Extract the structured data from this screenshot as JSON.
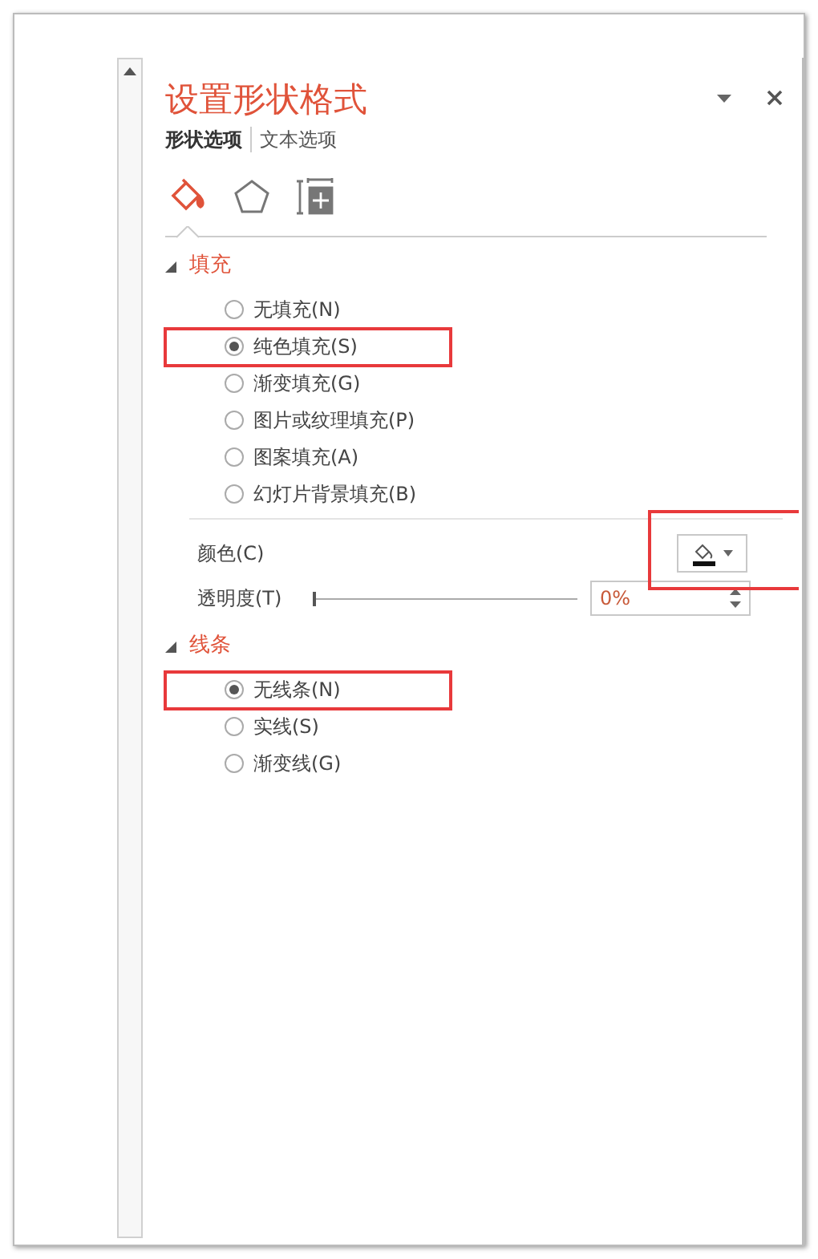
{
  "panel": {
    "title": "设置形状格式",
    "tabs": [
      {
        "label": "形状选项",
        "selected": true
      },
      {
        "label": "文本选项",
        "selected": false
      }
    ],
    "icon_tabs": [
      {
        "kind": "fill",
        "selected": true
      },
      {
        "kind": "effects",
        "selected": false
      },
      {
        "kind": "size",
        "selected": false
      }
    ],
    "sections": [
      {
        "title": "填充",
        "expanded": true,
        "options": [
          {
            "label": "无填充(N)",
            "selected": false,
            "highlighted": false
          },
          {
            "label": "纯色填充(S)",
            "selected": true,
            "highlighted": true
          },
          {
            "label": "渐变填充(G)",
            "selected": false,
            "highlighted": false
          },
          {
            "label": "图片或纹理填充(P)",
            "selected": false,
            "highlighted": false
          },
          {
            "label": "图案填充(A)",
            "selected": false,
            "highlighted": false
          },
          {
            "label": "幻灯片背景填充(B)",
            "selected": false,
            "highlighted": false
          }
        ],
        "color": {
          "label": "颜色(C)",
          "highlighted": true
        },
        "transparency": {
          "label": "透明度(T)",
          "level": 0,
          "value": "0%"
        }
      },
      {
        "title": "线条",
        "expanded": true,
        "options": [
          {
            "label": "无线条(N)",
            "selected": true,
            "highlighted": true
          },
          {
            "label": "实线(S)",
            "selected": false,
            "highlighted": false
          },
          {
            "label": "渐变线(G)",
            "selected": false,
            "highlighted": false
          }
        ]
      }
    ]
  }
}
